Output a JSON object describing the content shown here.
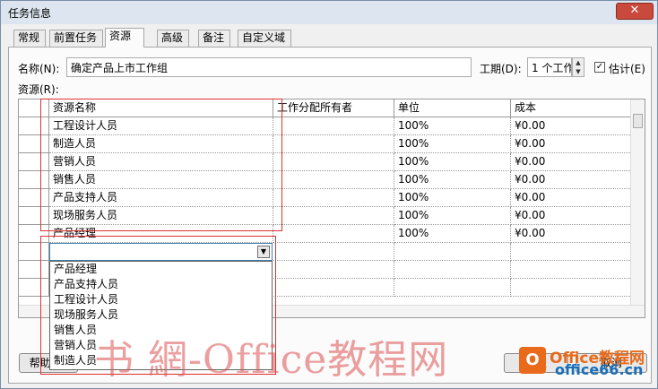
{
  "window": {
    "title": "任务信息",
    "close_glyph": "✕"
  },
  "tabs": [
    "常规",
    "前置任务",
    "资源",
    "高级",
    "备注",
    "自定义域"
  ],
  "form": {
    "name_label": "名称(N):",
    "name_value": "确定产品上市工作组",
    "duration_label": "工期(D):",
    "duration_value": "1 个工作",
    "estimate_label": "估计(E)",
    "estimate_checked": true,
    "resources_label": "资源(R):"
  },
  "grid": {
    "headers": [
      "资源名称",
      "工作分配所有者",
      "单位",
      "成本"
    ],
    "rows": [
      [
        "工程设计人员",
        "",
        "100%",
        "¥0.00"
      ],
      [
        "制造人员",
        "",
        "100%",
        "¥0.00"
      ],
      [
        "营销人员",
        "",
        "100%",
        "¥0.00"
      ],
      [
        "销售人员",
        "",
        "100%",
        "¥0.00"
      ],
      [
        "产品支持人员",
        "",
        "100%",
        "¥0.00"
      ],
      [
        "现场服务人员",
        "",
        "100%",
        "¥0.00"
      ],
      [
        "产品经理",
        "",
        "100%",
        "¥0.00"
      ]
    ]
  },
  "dropdown": {
    "items": [
      "产品经理",
      "产品支持人员",
      "工程设计人员",
      "现场服务人员",
      "销售人员",
      "营销人员",
      "制造人员"
    ]
  },
  "buttons": {
    "help": "帮助(H)",
    "ok": "确定",
    "cancel": "取消"
  },
  "watermark": {
    "text": "书 網-Office教程网",
    "brand_logo": "O",
    "brand_line1": "Office教程网",
    "brand_line2": "office66.cn"
  },
  "colors": {
    "annotation_red": "#e03030",
    "brand_orange": "#e86a1a",
    "brand_blue": "#1a6fb8"
  }
}
